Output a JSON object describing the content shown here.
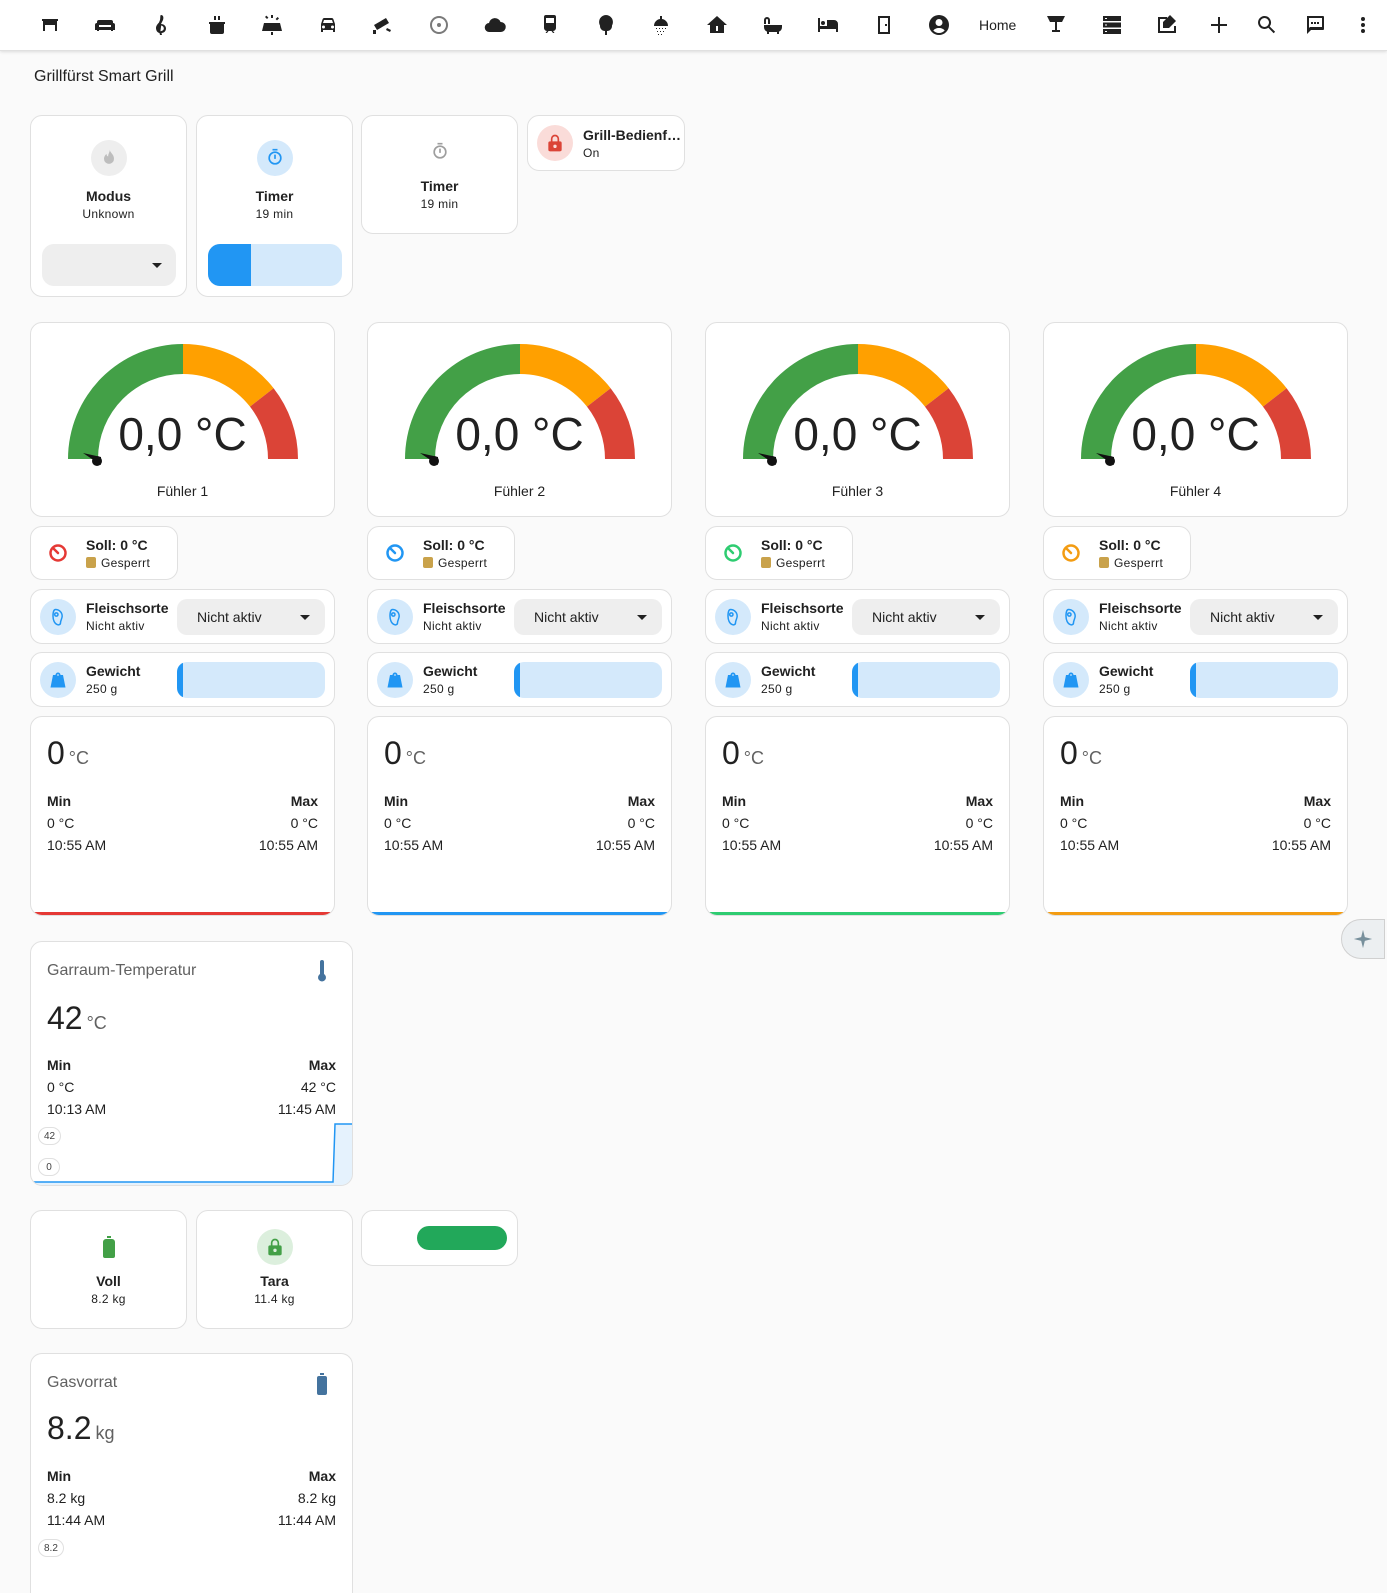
{
  "nav": {
    "tabs": [
      {
        "icon": "grill-icon"
      },
      {
        "icon": "sofa-icon"
      },
      {
        "icon": "music-clef-icon"
      },
      {
        "icon": "pot-icon"
      },
      {
        "icon": "solar-panel-icon"
      },
      {
        "icon": "car-icon"
      },
      {
        "icon": "cctv-icon"
      },
      {
        "icon": "atom-icon"
      },
      {
        "icon": "cloud-icon"
      },
      {
        "icon": "train-icon"
      },
      {
        "icon": "tree-icon"
      },
      {
        "icon": "shower-icon"
      },
      {
        "icon": "home-icon"
      },
      {
        "icon": "bathtub-icon"
      },
      {
        "icon": "bed-icon"
      },
      {
        "icon": "door-icon"
      },
      {
        "icon": "account-icon"
      }
    ],
    "home_label": "Home",
    "tabs_after": [
      {
        "icon": "desk-lamp-icon"
      },
      {
        "icon": "server-icon"
      },
      {
        "icon": "blueprint-icon"
      }
    ],
    "actions": [
      {
        "icon": "plus-icon"
      },
      {
        "icon": "search-icon"
      },
      {
        "icon": "assist-chat-icon"
      },
      {
        "icon": "dots-vertical-icon"
      }
    ]
  },
  "view_title": "Grillfürst Smart Grill",
  "top_tiles": {
    "modus": {
      "name": "Modus",
      "state": "Unknown"
    },
    "timer1": {
      "name": "Timer",
      "state": "19 min",
      "slider_fraction": 0.32
    },
    "timer2": {
      "name": "Timer",
      "state": "19 min"
    },
    "lock": {
      "name": "Grill-Bedienf…",
      "state": "On"
    }
  },
  "probes": [
    {
      "gauge_value": "0,0 °C",
      "name": "Fühler 1",
      "color": "#e53935",
      "soll": "Soll: 0 °C",
      "locked": "Gesperrt",
      "fleisch_name": "Fleischsorte",
      "fleisch_state": "Nicht aktiv",
      "fleisch_select": "Nicht aktiv",
      "gewicht_name": "Gewicht",
      "gewicht_state": "250 g",
      "stat": {
        "value": "0",
        "unit": "°C",
        "min_label": "Min",
        "max_label": "Max",
        "min": "0 °C",
        "max": "0 °C",
        "min_time": "10:55 AM",
        "max_time": "10:55 AM"
      }
    },
    {
      "gauge_value": "0,0 °C",
      "name": "Fühler 2",
      "color": "#2196f3",
      "soll": "Soll: 0 °C",
      "locked": "Gesperrt",
      "fleisch_name": "Fleischsorte",
      "fleisch_state": "Nicht aktiv",
      "fleisch_select": "Nicht aktiv",
      "gewicht_name": "Gewicht",
      "gewicht_state": "250 g",
      "stat": {
        "value": "0",
        "unit": "°C",
        "min_label": "Min",
        "max_label": "Max",
        "min": "0 °C",
        "max": "0 °C",
        "min_time": "10:55 AM",
        "max_time": "10:55 AM"
      }
    },
    {
      "gauge_value": "0,0 °C",
      "name": "Fühler 3",
      "color": "#2ecc71",
      "soll": "Soll: 0 °C",
      "locked": "Gesperrt",
      "fleisch_name": "Fleischsorte",
      "fleisch_state": "Nicht aktiv",
      "fleisch_select": "Nicht aktiv",
      "gewicht_name": "Gewicht",
      "gewicht_state": "250 g",
      "stat": {
        "value": "0",
        "unit": "°C",
        "min_label": "Min",
        "max_label": "Max",
        "min": "0 °C",
        "max": "0 °C",
        "min_time": "10:55 AM",
        "max_time": "10:55 AM"
      }
    },
    {
      "gauge_value": "0,0 °C",
      "name": "Fühler 4",
      "color": "#f39c12",
      "soll": "Soll: 0 °C",
      "locked": "Gesperrt",
      "fleisch_name": "Fleischsorte",
      "fleisch_state": "Nicht aktiv",
      "fleisch_select": "Nicht aktiv",
      "gewicht_name": "Gewicht",
      "gewicht_state": "250 g",
      "stat": {
        "value": "0",
        "unit": "°C",
        "min_label": "Min",
        "max_label": "Max",
        "min": "0 °C",
        "max": "0 °C",
        "min_time": "10:55 AM",
        "max_time": "10:55 AM"
      }
    }
  ],
  "garraum": {
    "title": "Garraum-Temperatur",
    "value": "42",
    "unit": "°C",
    "min_label": "Min",
    "max_label": "Max",
    "min": "0 °C",
    "max": "42 °C",
    "min_time": "10:13 AM",
    "max_time": "11:45 AM",
    "graph_top": "42",
    "graph_bottom": "0"
  },
  "gas_tiles": {
    "voll": {
      "name": "Voll",
      "state": "8.2 kg"
    },
    "tara": {
      "name": "Tara",
      "state": "11.4 kg"
    }
  },
  "gasvorrat": {
    "title": "Gasvorrat",
    "value": "8.2",
    "unit": "kg",
    "min_label": "Min",
    "max_label": "Max",
    "min": "8.2 kg",
    "max": "8.2 kg",
    "min_time": "11:44 AM",
    "max_time": "11:44 AM",
    "graph_top": "8.2"
  },
  "colors": {
    "green": "#43a047",
    "orange": "#ffa000",
    "red": "#db4437",
    "blue": "#2196f3",
    "toggle_green": "#22a85a"
  }
}
